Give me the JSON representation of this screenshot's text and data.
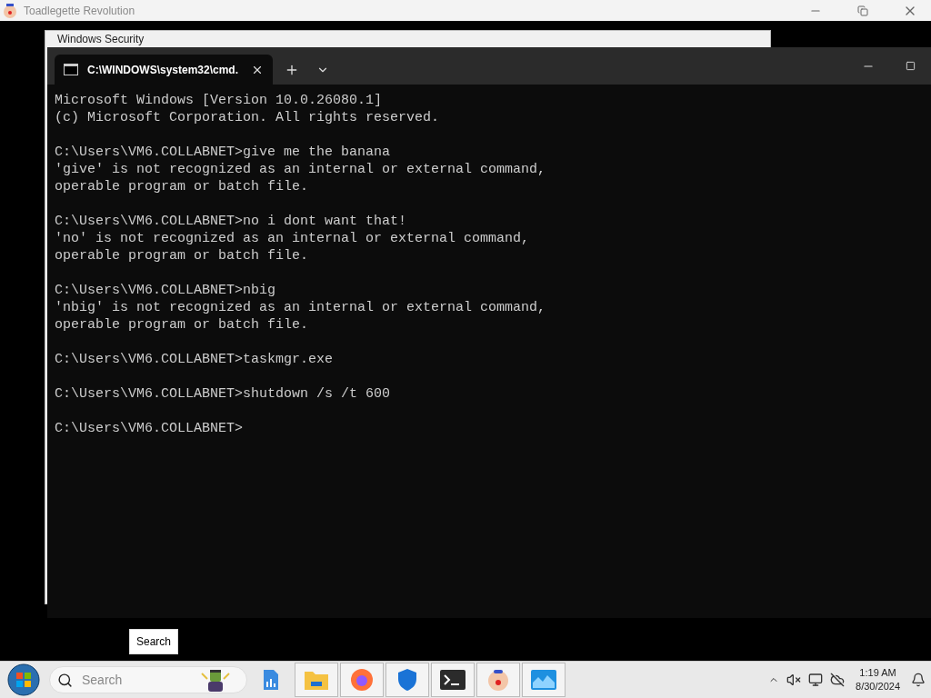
{
  "app_window": {
    "title": "Toadlegette Revolution"
  },
  "background_window": {
    "title": "Windows Security"
  },
  "terminal": {
    "tabs": [
      {
        "title": "C:\\WINDOWS\\system32\\cmd.",
        "selected": true
      }
    ],
    "blocks": [
      [
        "Microsoft Windows [Version 10.0.26080.1]",
        "(c) Microsoft Corporation. All rights reserved."
      ],
      [
        "C:\\Users\\VM6.COLLABNET>give me the banana",
        "'give' is not recognized as an internal or external command,",
        "operable program or batch file."
      ],
      [
        "C:\\Users\\VM6.COLLABNET>no i dont want that!",
        "'no' is not recognized as an internal or external command,",
        "operable program or batch file."
      ],
      [
        "C:\\Users\\VM6.COLLABNET>nbig",
        "'nbig' is not recognized as an internal or external command,",
        "operable program or batch file."
      ],
      [
        "C:\\Users\\VM6.COLLABNET>taskmgr.exe"
      ],
      [
        "C:\\Users\\VM6.COLLABNET>shutdown /s /t 600"
      ],
      [
        "C:\\Users\\VM6.COLLABNET>"
      ]
    ]
  },
  "tooltip": "Search",
  "taskbar": {
    "search": {
      "placeholder": "Search"
    },
    "apps": [
      {
        "running": false
      },
      {
        "running": true
      },
      {
        "running": true
      },
      {
        "running": true
      },
      {
        "running": true
      },
      {
        "running": true
      },
      {
        "running": true
      }
    ],
    "clock": {
      "time": "1:19 AM",
      "date": "8/30/2024"
    }
  }
}
